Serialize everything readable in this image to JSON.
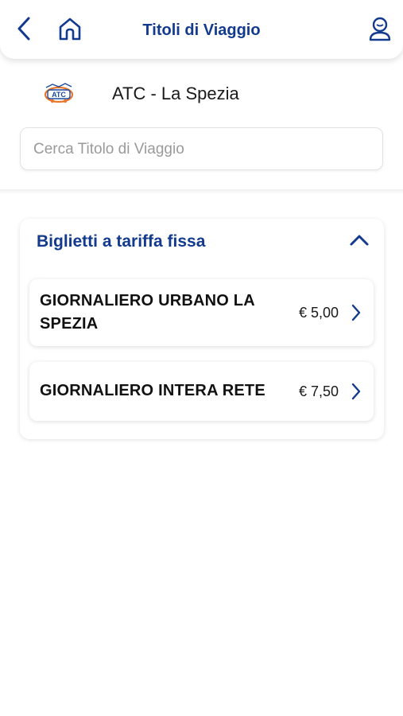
{
  "header": {
    "title": "Titoli di Viaggio",
    "back_icon": "chevron-left-icon",
    "home_icon": "home-icon",
    "user_icon": "user-icon"
  },
  "operator": {
    "logo_icon": "atc-logo",
    "logo_text": "ATC",
    "name": "ATC - La Spezia"
  },
  "search": {
    "placeholder": "Cerca Titolo di Viaggio",
    "value": ""
  },
  "section": {
    "title": "Biglietti a tariffa fissa",
    "expanded": true,
    "toggle_icon": "chevron-up-icon",
    "tickets": [
      {
        "name": "GIORNALIERO URBANO LA SPEZIA",
        "price": "€ 5,00",
        "icon": "chevron-right-icon"
      },
      {
        "name": "GIORNALIERO INTERA RETE",
        "price": "€ 7,50",
        "icon": "chevron-right-icon"
      }
    ]
  },
  "colors": {
    "brand_blue": "#123a8f",
    "text_dark": "#111111",
    "placeholder_gray": "#9a9a9a",
    "logo_orange": "#e8772e"
  }
}
